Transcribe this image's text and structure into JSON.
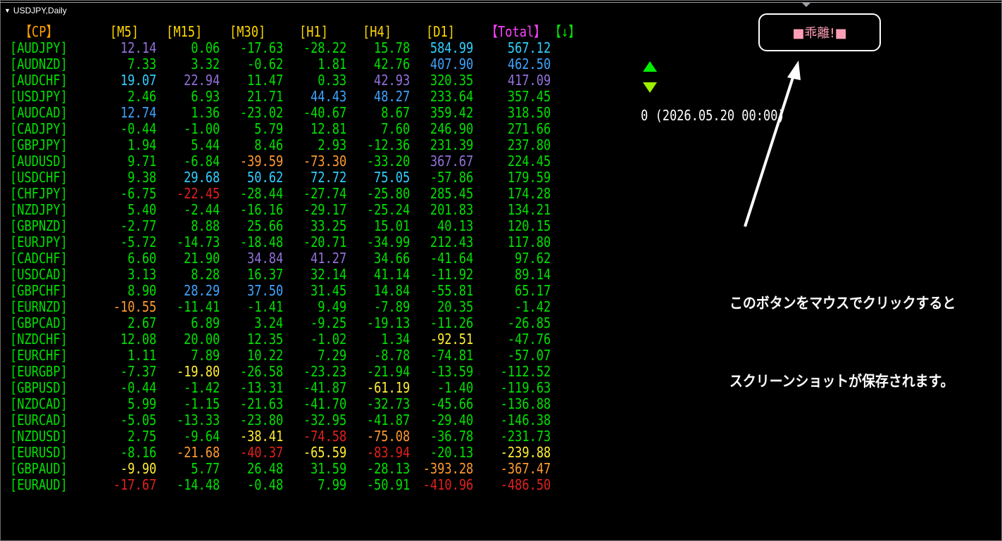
{
  "window": {
    "title": "USDJPY,Daily"
  },
  "headers": {
    "cp": "【CP】",
    "m5": "[M5]",
    "m15": "[M15]",
    "m30": "[M30]",
    "h1": "[H1]",
    "h4": "[H4]",
    "d1": "[D1]",
    "total": "【Total】",
    "sort": "【↓】"
  },
  "colors": {
    "green": "#00e000",
    "purple": "#9370db",
    "cyan": "#30d0ff",
    "blue": "#3ea4ff",
    "orange": "#ff9a30",
    "red": "#e02020",
    "yellow": "#ffee33",
    "sym": "#00e000",
    "hdr_cp": "#ffa000",
    "hdr_tf": "#ffd700",
    "hdr_total": "#ff40ff",
    "hdr_sort": "#00e000"
  },
  "rows": [
    {
      "sym": "[AUDJPY]",
      "vals": [
        "12.14",
        "0.06",
        "-17.63",
        "-28.22",
        "15.78",
        "584.99",
        "567.12"
      ],
      "col": [
        "purple",
        "green",
        "green",
        "green",
        "green",
        "cyan",
        "cyan"
      ]
    },
    {
      "sym": "[AUDNZD]",
      "vals": [
        "7.33",
        "3.32",
        "-0.62",
        "1.81",
        "42.76",
        "407.90",
        "462.50"
      ],
      "col": [
        "green",
        "green",
        "green",
        "green",
        "green",
        "blue",
        "blue"
      ]
    },
    {
      "sym": "[AUDCHF]",
      "vals": [
        "19.07",
        "22.94",
        "11.47",
        "0.33",
        "42.93",
        "320.35",
        "417.09"
      ],
      "col": [
        "cyan",
        "purple",
        "green",
        "green",
        "purple",
        "green",
        "purple"
      ]
    },
    {
      "sym": "[USDJPY]",
      "vals": [
        "2.46",
        "6.93",
        "21.71",
        "44.43",
        "48.27",
        "233.64",
        "357.45"
      ],
      "col": [
        "green",
        "green",
        "green",
        "blue",
        "blue",
        "green",
        "green"
      ]
    },
    {
      "sym": "[AUDCAD]",
      "vals": [
        "12.74",
        "1.36",
        "-23.02",
        "-40.67",
        "8.67",
        "359.42",
        "318.50"
      ],
      "col": [
        "blue",
        "green",
        "green",
        "green",
        "green",
        "green",
        "green"
      ]
    },
    {
      "sym": "[CADJPY]",
      "vals": [
        "-0.44",
        "-1.00",
        "5.79",
        "12.81",
        "7.60",
        "246.90",
        "271.66"
      ],
      "col": [
        "green",
        "green",
        "green",
        "green",
        "green",
        "green",
        "green"
      ]
    },
    {
      "sym": "[GBPJPY]",
      "vals": [
        "1.94",
        "5.44",
        "8.46",
        "2.93",
        "-12.36",
        "231.39",
        "237.80"
      ],
      "col": [
        "green",
        "green",
        "green",
        "green",
        "green",
        "green",
        "green"
      ]
    },
    {
      "sym": "[AUDUSD]",
      "vals": [
        "9.71",
        "-6.84",
        "-39.59",
        "-73.30",
        "-33.20",
        "367.67",
        "224.45"
      ],
      "col": [
        "green",
        "green",
        "orange",
        "orange",
        "green",
        "purple",
        "green"
      ]
    },
    {
      "sym": "[USDCHF]",
      "vals": [
        "9.38",
        "29.68",
        "50.62",
        "72.72",
        "75.05",
        "-57.86",
        "179.59"
      ],
      "col": [
        "green",
        "cyan",
        "cyan",
        "cyan",
        "cyan",
        "green",
        "green"
      ]
    },
    {
      "sym": "[CHFJPY]",
      "vals": [
        "-6.75",
        "-22.45",
        "-28.44",
        "-27.74",
        "-25.80",
        "285.45",
        "174.28"
      ],
      "col": [
        "green",
        "red",
        "green",
        "green",
        "green",
        "green",
        "green"
      ]
    },
    {
      "sym": "[NZDJPY]",
      "vals": [
        "5.40",
        "-2.44",
        "-16.16",
        "-29.17",
        "-25.24",
        "201.83",
        "134.21"
      ],
      "col": [
        "green",
        "green",
        "green",
        "green",
        "green",
        "green",
        "green"
      ]
    },
    {
      "sym": "[GBPNZD]",
      "vals": [
        "-2.77",
        "8.88",
        "25.66",
        "33.25",
        "15.01",
        "40.13",
        "120.15"
      ],
      "col": [
        "green",
        "green",
        "green",
        "green",
        "green",
        "green",
        "green"
      ]
    },
    {
      "sym": "[EURJPY]",
      "vals": [
        "-5.72",
        "-14.73",
        "-18.48",
        "-20.71",
        "-34.99",
        "212.43",
        "117.80"
      ],
      "col": [
        "green",
        "green",
        "green",
        "green",
        "green",
        "green",
        "green"
      ]
    },
    {
      "sym": "[CADCHF]",
      "vals": [
        "6.60",
        "21.90",
        "34.84",
        "41.27",
        "34.66",
        "-41.64",
        "97.62"
      ],
      "col": [
        "green",
        "green",
        "purple",
        "purple",
        "green",
        "green",
        "green"
      ]
    },
    {
      "sym": "[USDCAD]",
      "vals": [
        "3.13",
        "8.28",
        "16.37",
        "32.14",
        "41.14",
        "-11.92",
        "89.14"
      ],
      "col": [
        "green",
        "green",
        "green",
        "green",
        "green",
        "green",
        "green"
      ]
    },
    {
      "sym": "[GBPCHF]",
      "vals": [
        "8.90",
        "28.29",
        "37.50",
        "31.45",
        "14.84",
        "-55.81",
        "65.17"
      ],
      "col": [
        "green",
        "blue",
        "blue",
        "green",
        "green",
        "green",
        "green"
      ]
    },
    {
      "sym": "[EURNZD]",
      "vals": [
        "-10.55",
        "-11.41",
        "-1.41",
        "9.49",
        "-7.89",
        "20.35",
        "-1.42"
      ],
      "col": [
        "orange",
        "green",
        "green",
        "green",
        "green",
        "green",
        "green"
      ]
    },
    {
      "sym": "[GBPCAD]",
      "vals": [
        "2.67",
        "6.89",
        "3.24",
        "-9.25",
        "-19.13",
        "-11.26",
        "-26.85"
      ],
      "col": [
        "green",
        "green",
        "green",
        "green",
        "green",
        "green",
        "green"
      ]
    },
    {
      "sym": "[NZDCHF]",
      "vals": [
        "12.08",
        "20.00",
        "12.35",
        "-1.02",
        "1.34",
        "-92.51",
        "-47.76"
      ],
      "col": [
        "green",
        "green",
        "green",
        "green",
        "green",
        "yellow",
        "green"
      ]
    },
    {
      "sym": "[EURCHF]",
      "vals": [
        "1.11",
        "7.89",
        "10.22",
        "7.29",
        "-8.78",
        "-74.81",
        "-57.07"
      ],
      "col": [
        "green",
        "green",
        "green",
        "green",
        "green",
        "green",
        "green"
      ]
    },
    {
      "sym": "[EURGBP]",
      "vals": [
        "-7.37",
        "-19.80",
        "-26.58",
        "-23.23",
        "-21.94",
        "-13.59",
        "-112.52"
      ],
      "col": [
        "green",
        "yellow",
        "green",
        "green",
        "green",
        "green",
        "green"
      ]
    },
    {
      "sym": "[GBPUSD]",
      "vals": [
        "-0.44",
        "-1.42",
        "-13.31",
        "-41.87",
        "-61.19",
        "-1.40",
        "-119.63"
      ],
      "col": [
        "green",
        "green",
        "green",
        "green",
        "yellow",
        "green",
        "green"
      ]
    },
    {
      "sym": "[NZDCAD]",
      "vals": [
        "5.99",
        "-1.15",
        "-21.63",
        "-41.70",
        "-32.73",
        "-45.66",
        "-136.88"
      ],
      "col": [
        "green",
        "green",
        "green",
        "green",
        "green",
        "green",
        "green"
      ]
    },
    {
      "sym": "[EURCAD]",
      "vals": [
        "-5.05",
        "-13.33",
        "-23.80",
        "-32.95",
        "-41.87",
        "-29.40",
        "-146.38"
      ],
      "col": [
        "green",
        "green",
        "green",
        "green",
        "green",
        "green",
        "green"
      ]
    },
    {
      "sym": "[NZDUSD]",
      "vals": [
        "2.75",
        "-9.64",
        "-38.41",
        "-74.58",
        "-75.08",
        "-36.78",
        "-231.73"
      ],
      "col": [
        "green",
        "green",
        "yellow",
        "red",
        "orange",
        "green",
        "green"
      ]
    },
    {
      "sym": "[EURUSD]",
      "vals": [
        "-8.16",
        "-21.68",
        "-40.37",
        "-65.59",
        "-83.94",
        "-20.13",
        "-239.88"
      ],
      "col": [
        "green",
        "orange",
        "red",
        "yellow",
        "red",
        "green",
        "yellow"
      ]
    },
    {
      "sym": "[GBPAUD]",
      "vals": [
        "-9.90",
        "5.77",
        "26.48",
        "31.59",
        "-28.13",
        "-393.28",
        "-367.47"
      ],
      "col": [
        "yellow",
        "green",
        "green",
        "green",
        "green",
        "orange",
        "orange"
      ]
    },
    {
      "sym": "[EURAUD]",
      "vals": [
        "-17.67",
        "-14.48",
        "-0.48",
        "7.99",
        "-50.91",
        "-410.96",
        "-486.50"
      ],
      "col": [
        "red",
        "green",
        "green",
        "green",
        "green",
        "red",
        "red"
      ]
    }
  ],
  "button": {
    "label": "■乖離!■"
  },
  "signals": {
    "up": "up-triangle",
    "down": "down-triangle"
  },
  "status": "0 (2026.05.20 00:00)",
  "note": {
    "line1": "このボタンをマウスでクリックすると",
    "line2": "スクリーンショットが保存されます。"
  }
}
